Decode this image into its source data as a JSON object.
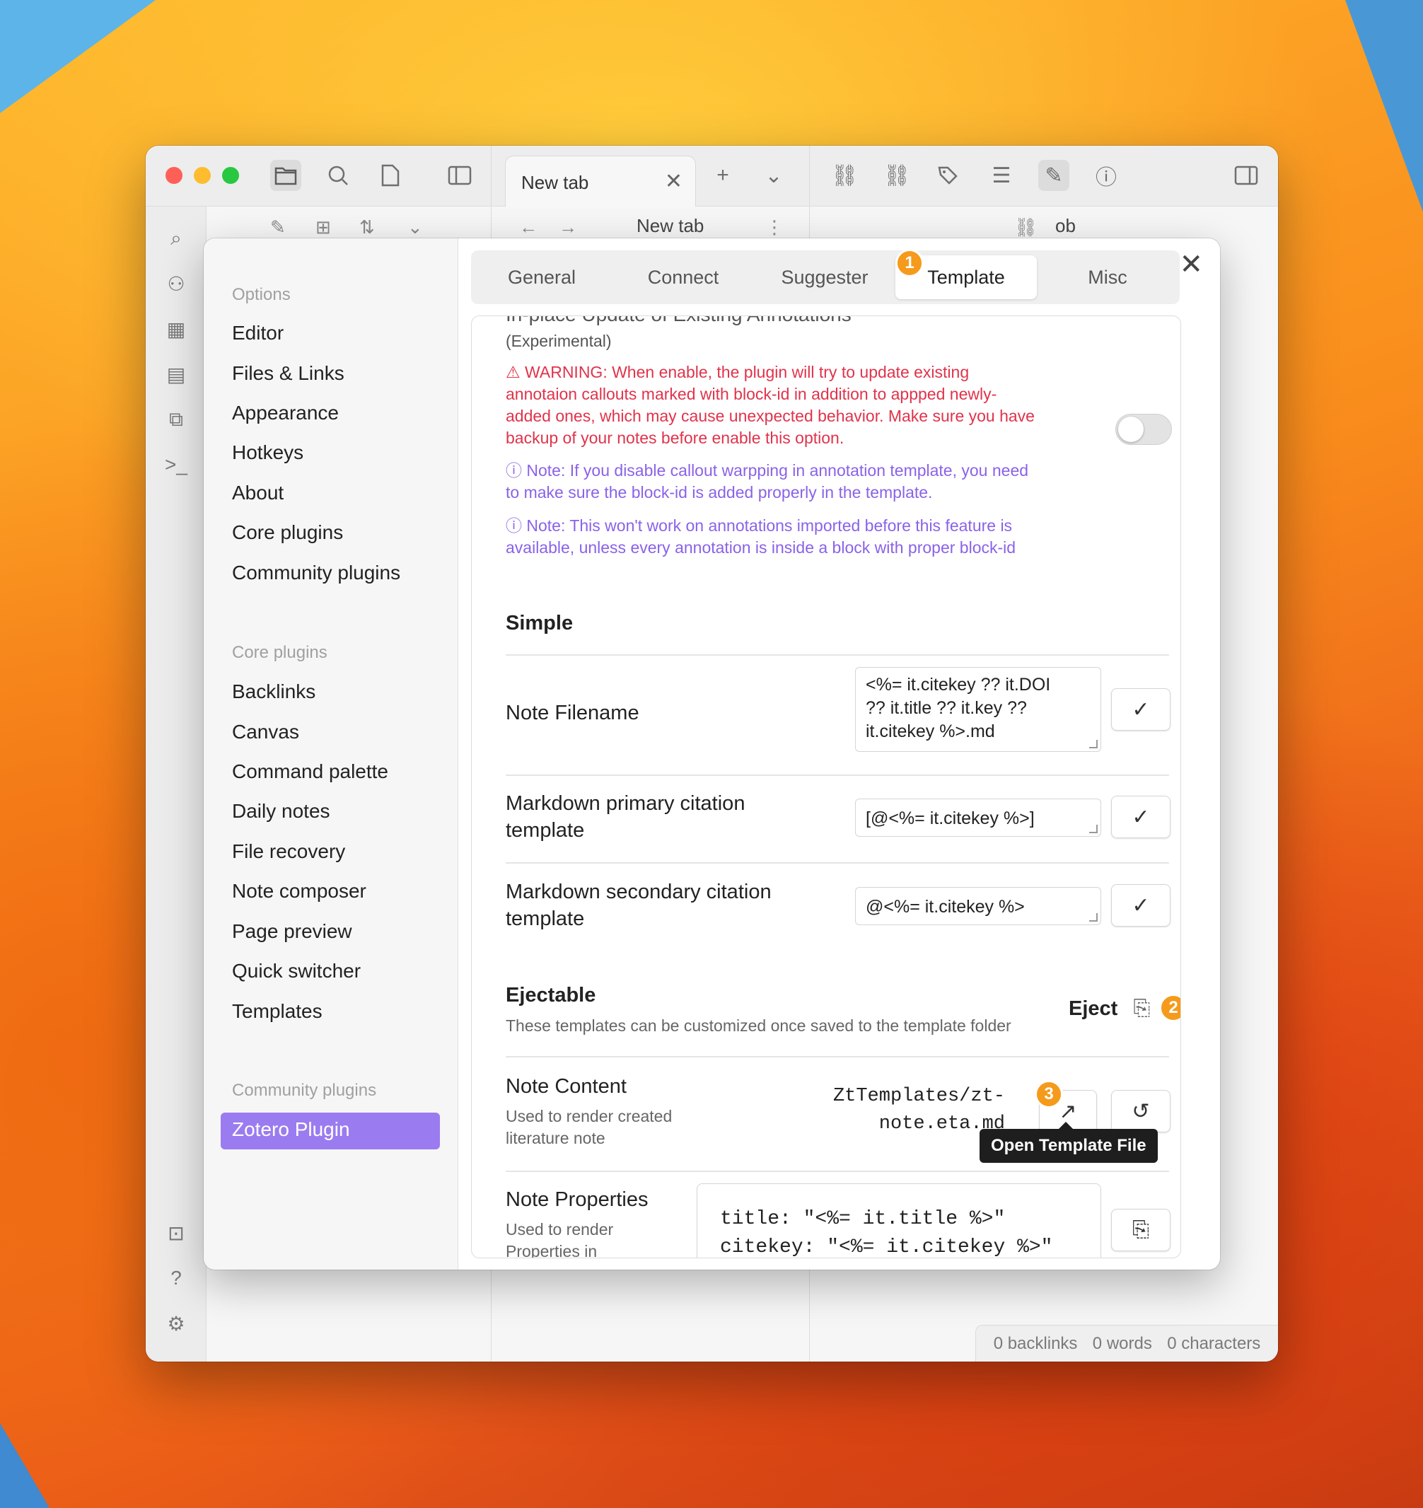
{
  "titlebar": {
    "tab_title": "New tab",
    "subbar_title": "New tab",
    "right_title": "ob"
  },
  "statusbar": {
    "backlinks": "0 backlinks",
    "words": "0 words",
    "characters": "0 characters"
  },
  "settings": {
    "sidebar": {
      "options_header": "Options",
      "options": [
        "Editor",
        "Files & Links",
        "Appearance",
        "Hotkeys",
        "About",
        "Core plugins",
        "Community plugins"
      ],
      "core_header": "Core plugins",
      "core": [
        "Backlinks",
        "Canvas",
        "Command palette",
        "Daily notes",
        "File recovery",
        "Note composer",
        "Page preview",
        "Quick switcher",
        "Templates"
      ],
      "community_header": "Community plugins",
      "community": [
        "Zotero Plugin"
      ]
    },
    "tabs": [
      "General",
      "Connect",
      "Suggester",
      "Template",
      "Misc"
    ],
    "active_tab": "Template",
    "badges": [
      "1",
      "2",
      "3"
    ],
    "inplace": {
      "title_cut": "In-place Update of Existing Annotations",
      "experimental": "(Experimental)",
      "warning": [
        "⚠ WARNING: When enable, the plugin will try to update existing",
        "annotaion callouts marked with block-id in addition to appped newly-",
        "added ones, which may cause unexpected behavior. Make sure you have",
        "backup of your notes before enable this option."
      ],
      "note1": [
        "ⓘ Note: If you disable callout warpping in annotation template, you need",
        "to make sure the block-id is added properly in the template."
      ],
      "note2": [
        "ⓘ Note: This won't work on annotations imported before this feature is",
        "available, unless every annotation is inside a block with proper block-id"
      ]
    },
    "simple": {
      "heading": "Simple",
      "filename_label": "Note Filename",
      "filename_value": [
        "<%= it.citekey ?? it.DOI",
        "?? it.title ?? it.key ??",
        "it.citekey %>.md"
      ],
      "primary_label": [
        "Markdown primary citation",
        "template"
      ],
      "primary_value": "[@<%= it.citekey %>]",
      "secondary_label": [
        "Markdown secondary citation",
        "template"
      ],
      "secondary_value": "@<%= it.citekey %>"
    },
    "ejectable": {
      "heading": "Ejectable",
      "desc": "These templates can be customized once saved to the template folder",
      "eject_label": "Eject",
      "content_label": "Note Content",
      "content_desc": [
        "Used to render created",
        "literature note"
      ],
      "content_path": [
        "ZtTemplates/zt-",
        "note.eta.md"
      ],
      "tooltip": "Open Template File",
      "props_label": "Note Properties",
      "props_desc": [
        "Used to render",
        "Properties in"
      ],
      "props_value": [
        "title: \"<%= it.title %>\"",
        "citekey: \"<%= it.citekey %>\""
      ]
    }
  },
  "colors": {
    "accent": "#9b7bf0",
    "warning": "#e0334b",
    "note": "#8a62e8",
    "badge": "#f59a1b"
  }
}
